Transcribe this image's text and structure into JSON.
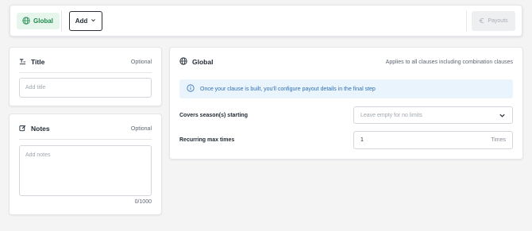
{
  "toolbar": {
    "global_label": "Global",
    "add_label": "Add",
    "payouts_label": "Payouts"
  },
  "title_card": {
    "heading": "Title",
    "optional": "Optional",
    "placeholder": "Add title"
  },
  "notes_card": {
    "heading": "Notes",
    "optional": "Optional",
    "placeholder": "Add notes",
    "counter": "0/1000"
  },
  "global_card": {
    "heading": "Global",
    "subtitle": "Applies to all clauses including combination clauses",
    "info": "Once your clause is built, you'll configure payout details in the final step",
    "covers_label": "Covers season(s) starting",
    "covers_placeholder": "Leave empty for no limits",
    "recurring_label": "Recurring max times",
    "recurring_value": "1",
    "recurring_unit": "Times"
  },
  "colors": {
    "accent_green": "#1e8a4c",
    "chip_bg": "#e6f6ec",
    "info_blue": "#2f6fb0",
    "info_bg": "#eaf4fd"
  },
  "icons": [
    "globe-icon",
    "chevron-down-icon",
    "euro-icon",
    "title-text-icon",
    "notes-edit-icon",
    "info-icon"
  ]
}
